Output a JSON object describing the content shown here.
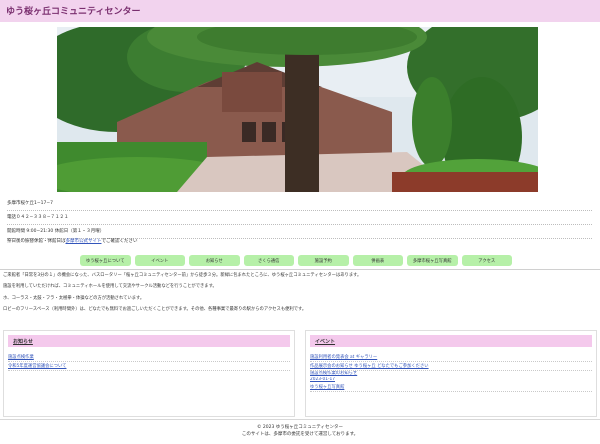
{
  "site": {
    "title": "ゆう桜ヶ丘コミュニティセンター"
  },
  "hero": {
    "alt": ""
  },
  "info": {
    "address": "多摩市桜ケ丘1−17−7",
    "tel": "電話０４２−３３８−７１２１",
    "hours": "開館時間 9:00−21:30 休館日（第１・３月曜）",
    "holiday_prefix": "祭日後の振替休館・休館日は",
    "holiday_link": "多摩市公式サイト",
    "holiday_suffix": "でご確認ください"
  },
  "nav": {
    "items": [
      "ゆう桜ヶ丘について",
      "イベント",
      "お知らせ",
      "さくら通信",
      "施設予約",
      "併画表",
      "多摩市桜ヶ丘写真館",
      "アクセス"
    ]
  },
  "description": {
    "line1": "ご来館者「日常を3分の１」の機会になった、バスロータリー「桜ヶ丘コミュニティセンター前」から徒歩３分。新緑に包まれたところに、ゆう桜ヶ丘コミュニティセンターはあります。",
    "line2": "施設を利用していただければ、コミュニティホールを使用して交流やサークル活動などを行うことができます。",
    "line3": "ホ、コーラス・太鼓・フラ・太極拳・体操などの方が活動されています。",
    "line4": "ロビーのフリースペース（利用時間外）は、どなたでも無料でお過ごしいただくことができます。その他、各種事業で最寄りの駅からのアクセスも便利です。"
  },
  "panels": {
    "news": {
      "title": "お知らせ",
      "items": [
        "施設点検作業",
        "令和5年度運営協議会について"
      ]
    },
    "events": {
      "title": "イベント",
      "items": [
        "施設利用者の発表会 at ギャラリー",
        "作品展示会のお知らせ ゆう桜ヶ丘 どなたでもご参加ください",
        "施設点検作業のお知らせ"
      ],
      "date": "2023-01-17",
      "last_item": "ゆう桜ヶ丘写真館"
    }
  },
  "footer": {
    "copyright": "© 2023 ゆう桜ヶ丘コミュニティセンター",
    "disclaimer": "このサイトは、多摩市の委託を受けて運営しております。"
  },
  "colors": {
    "header_bg": "#f2d3ee",
    "nav_bg": "#b6f0a8",
    "panel_head_bg": "#f4c9ec",
    "link": "#3355bb"
  }
}
